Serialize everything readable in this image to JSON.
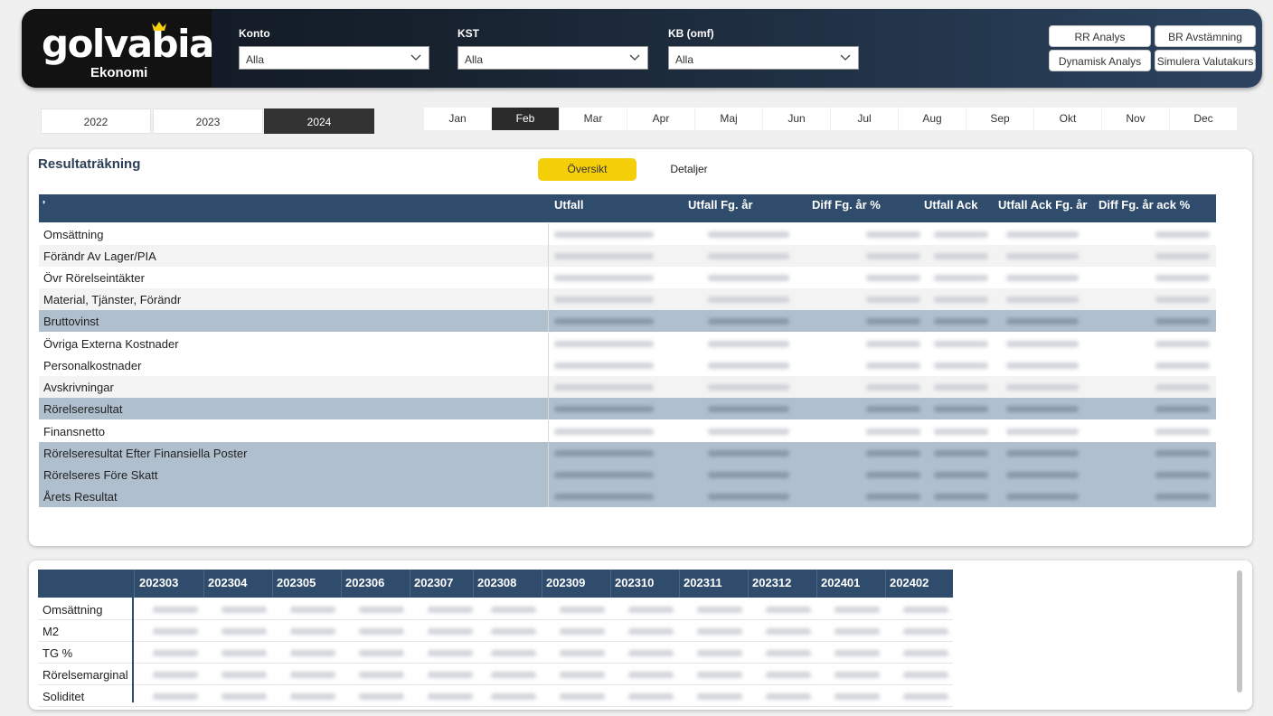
{
  "app": {
    "logo": "golvabia",
    "subtitle": "Ekonomi"
  },
  "filters": [
    {
      "label": "Konto",
      "value": "Alla"
    },
    {
      "label": "KST",
      "value": "Alla"
    },
    {
      "label": "KB (omf)",
      "value": "Alla"
    }
  ],
  "buttons": {
    "rr": "RR Analys",
    "br": "BR Avstämning",
    "dyn": "Dynamisk Analys",
    "sim": "Simulera Valutakurs"
  },
  "years": [
    "2022",
    "2023",
    "2024"
  ],
  "selected_year": "2024",
  "months": [
    "Jan",
    "Feb",
    "Mar",
    "Apr",
    "Maj",
    "Jun",
    "Jul",
    "Aug",
    "Sep",
    "Okt",
    "Nov",
    "Dec"
  ],
  "selected_month": "Feb",
  "result": {
    "title": "Resultaträkning",
    "tabs": {
      "overview": "Översikt",
      "details": "Detaljer"
    },
    "columns": [
      "'",
      "Utfall",
      "Utfall Fg. år",
      "Diff Fg. år %",
      "Utfall Ack",
      "Utfall Ack Fg. år",
      "Diff Fg. år ack %"
    ],
    "rows": [
      "Omsättning",
      "Förändr Av Lager/PIA",
      "Övr Rörelseintäkter",
      "Material, Tjänster, Förändr",
      "Bruttovinst",
      "Övriga Externa Kostnader",
      "Personalkostnader",
      "Avskrivningar",
      "Rörelseresultat",
      "Finansnetto",
      "Rörelseresultat Efter Finansiella Poster",
      "Rörelseres Före Skatt",
      "Årets Resultat"
    ]
  },
  "kpi": {
    "periods": [
      "202303",
      "202304",
      "202305",
      "202306",
      "202307",
      "202308",
      "202309",
      "202310",
      "202311",
      "202312",
      "202401",
      "202402"
    ],
    "rows": [
      "Omsättning",
      "M2",
      "TG %",
      "Rörelsemarginal",
      "Soliditet"
    ]
  },
  "colors": {
    "accent": "#f5cf0a",
    "header": "#2f4c6d",
    "highlight": "#afbfcd"
  }
}
